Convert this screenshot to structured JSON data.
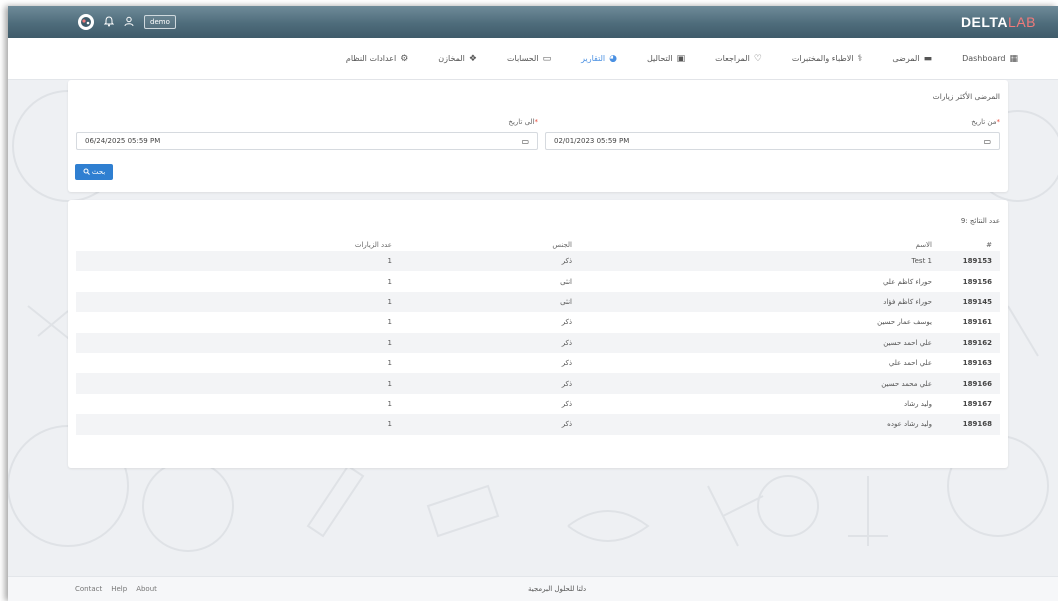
{
  "header": {
    "user_label": "demo",
    "brand_part1": "DELTA",
    "brand_part2": "LAB",
    "icons": [
      "logo-icon",
      "bell-icon",
      "user-icon"
    ]
  },
  "nav": {
    "items": [
      {
        "label": "Dashboard",
        "icon": "grid-icon",
        "active": false
      },
      {
        "label": "المرضى",
        "icon": "bed-icon",
        "active": false
      },
      {
        "label": "الاطباء والمختبرات",
        "icon": "doctor-icon",
        "active": false
      },
      {
        "label": "المراجعات",
        "icon": "heart-icon",
        "active": false
      },
      {
        "label": "التحاليل",
        "icon": "briefcase-icon",
        "active": false
      },
      {
        "label": "التقارير",
        "icon": "pie-chart-icon",
        "active": true
      },
      {
        "label": "الحسابات",
        "icon": "money-icon",
        "active": false
      },
      {
        "label": "المخازن",
        "icon": "boxes-icon",
        "active": false
      },
      {
        "label": "اعدادات النظام",
        "icon": "gear-icon",
        "active": false
      }
    ]
  },
  "filter": {
    "title": "المرضى الأكثر زيارات",
    "from_label": "من تاريخ",
    "from_value": "02/01/2023 05:59 PM",
    "to_label": "الى تاريخ",
    "to_value": "06/24/2025 05:59 PM",
    "required_mark": "*",
    "search_label": "بحث"
  },
  "results": {
    "count_label": "عدد النتائج :9",
    "columns": [
      "#",
      "الاسم",
      "الجنس",
      "عدد الزيارات"
    ],
    "rows": [
      {
        "id": "189153",
        "name": "Test 1",
        "gender": "ذكر",
        "visits": "1"
      },
      {
        "id": "189156",
        "name": "حوراء كاظم علي",
        "gender": "انثى",
        "visits": "1"
      },
      {
        "id": "189145",
        "name": "حوراء كاظم فؤاد",
        "gender": "انثى",
        "visits": "1"
      },
      {
        "id": "189161",
        "name": "يوسف عمار حسين",
        "gender": "ذكر",
        "visits": "1"
      },
      {
        "id": "189162",
        "name": "علي احمد حسين",
        "gender": "ذكر",
        "visits": "1"
      },
      {
        "id": "189163",
        "name": "علي احمد علي",
        "gender": "ذكر",
        "visits": "1"
      },
      {
        "id": "189166",
        "name": "علي محمد حسين",
        "gender": "ذكر",
        "visits": "1"
      },
      {
        "id": "189167",
        "name": "وليد رشاد",
        "gender": "ذكر",
        "visits": "1"
      },
      {
        "id": "189168",
        "name": "وليد رشاد عوده",
        "gender": "ذكر",
        "visits": "1"
      }
    ]
  },
  "footer": {
    "links": [
      "Contact",
      "Help",
      "About"
    ],
    "center_text": "دلتا للحلول البرمجية"
  },
  "colors": {
    "topbar": "#4e6c7b",
    "accent_blue": "#2f7fd1",
    "active_nav": "#4a90e2",
    "brand_lab": "#f07a7a"
  }
}
